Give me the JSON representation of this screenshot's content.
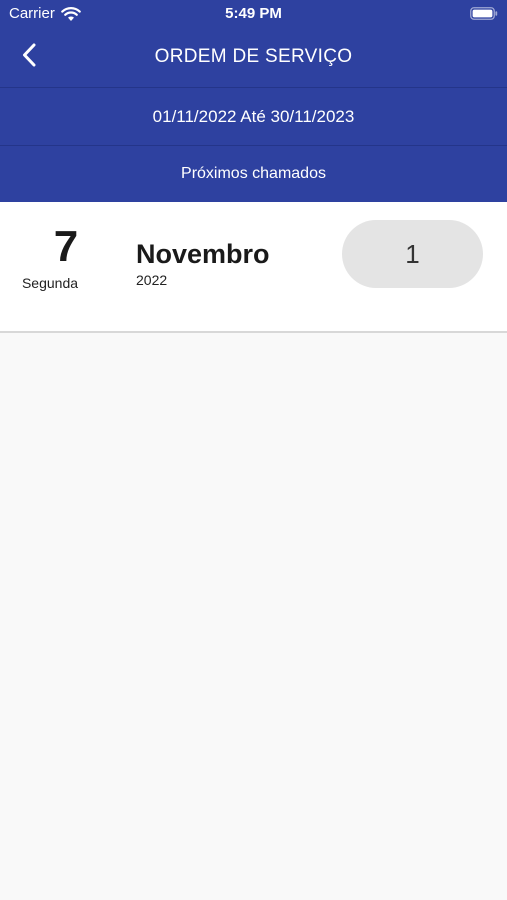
{
  "status_bar": {
    "carrier": "Carrier",
    "time": "5:49 PM",
    "icons": [
      "wifi-icon",
      "battery-icon"
    ]
  },
  "nav": {
    "title": "ORDEM DE SERVIÇO",
    "back_icon": "chevron-left-icon"
  },
  "filter": {
    "date_range": "01/11/2022 Até 30/11/2023"
  },
  "section": {
    "title": "Próximos chamados"
  },
  "items": [
    {
      "day": "7",
      "weekday": "Segunda",
      "month": "Novembro",
      "year": "2022",
      "count": "1"
    }
  ],
  "colors": {
    "primary": "#2e41a0",
    "background": "#f9f9f9",
    "pill": "#e4e4e4"
  }
}
